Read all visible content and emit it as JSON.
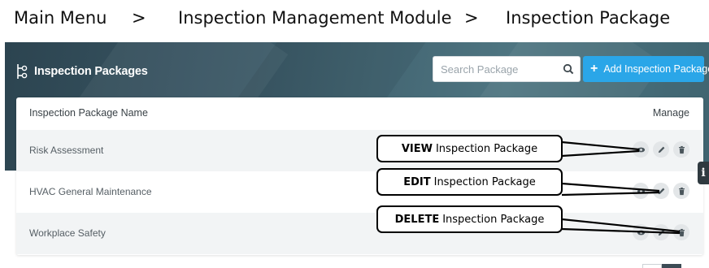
{
  "breadcrumb": {
    "items": [
      "Main Menu",
      "Inspection Management Module",
      "Inspection Package"
    ],
    "separator": ">"
  },
  "header": {
    "title": "Inspection Packages",
    "search_placeholder": "Search Package",
    "add_button_label": "Add Inspection Package"
  },
  "table": {
    "columns": {
      "name": "Inspection Package Name",
      "manage": "Manage"
    },
    "rows": [
      {
        "name": "Risk Assessment"
      },
      {
        "name": "HVAC General Maintenance"
      },
      {
        "name": "Workplace Safety"
      }
    ]
  },
  "callouts": {
    "view": {
      "bold": "VIEW",
      "text": "Inspection Package"
    },
    "edit": {
      "bold": "EDIT",
      "text": "Inspection Package"
    },
    "delete": {
      "bold": "DELETE",
      "text": "Inspection Package"
    }
  },
  "side_tab": {
    "label": "i"
  },
  "colors": {
    "header_bg": "#3a5866",
    "accent": "#2aa6e8",
    "row_alt": "#f2f4f5"
  },
  "icons": [
    "tree-icon",
    "search-icon",
    "plus-icon",
    "eye-icon",
    "pencil-icon",
    "trash-icon"
  ]
}
